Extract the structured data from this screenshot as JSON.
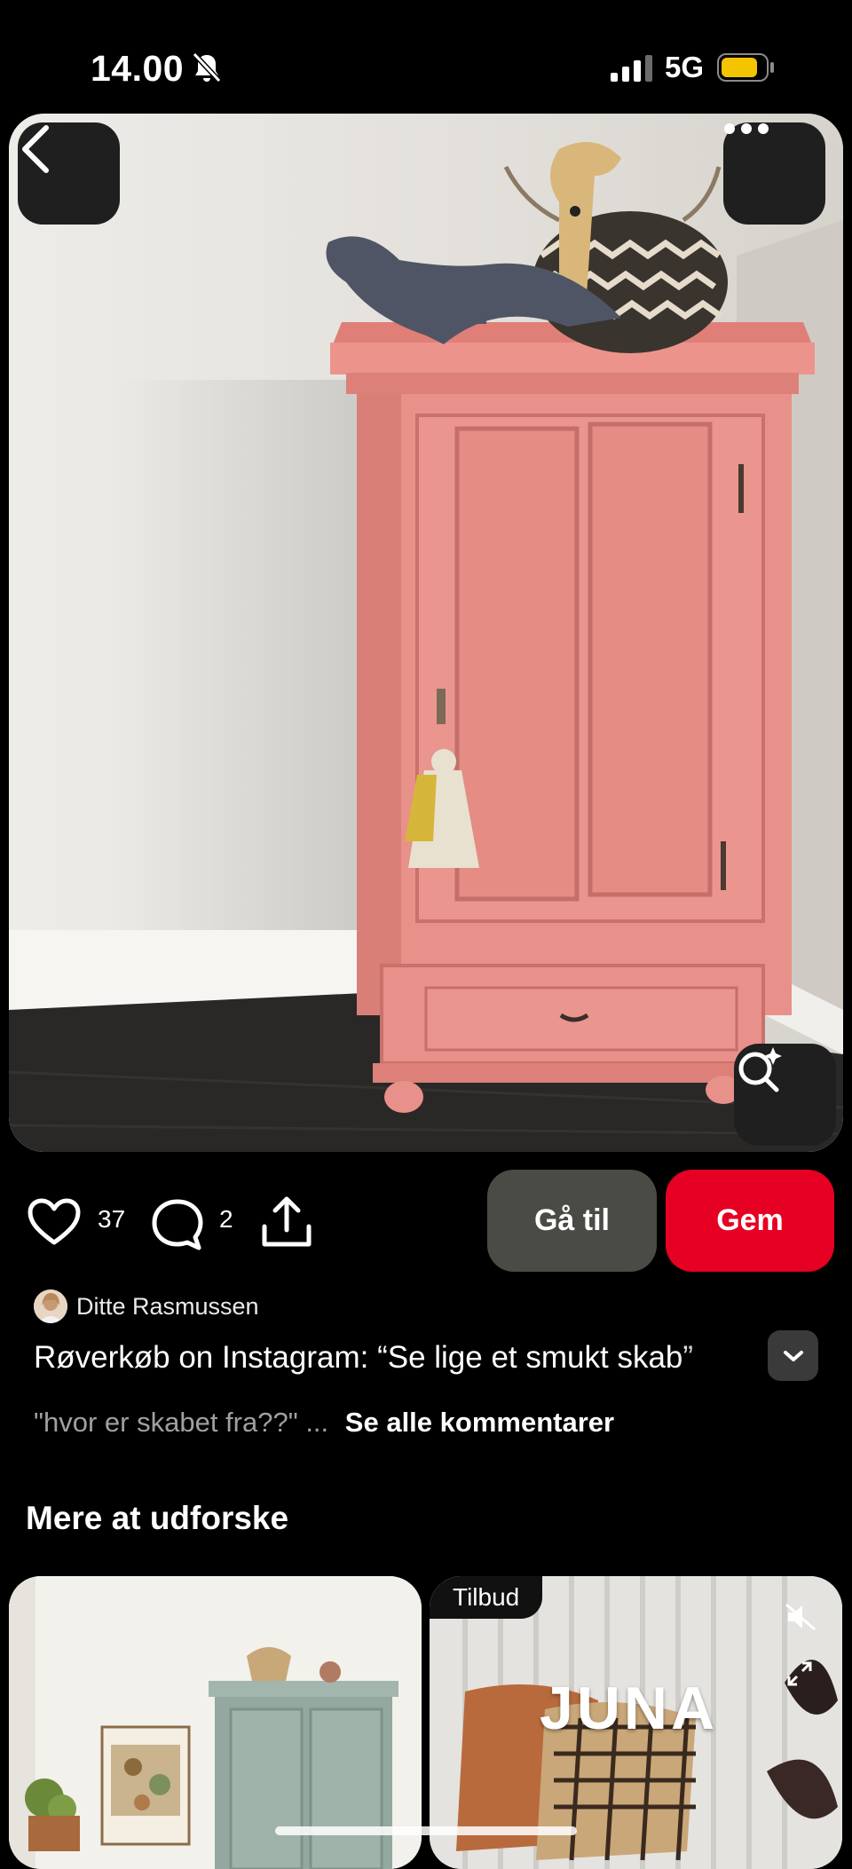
{
  "status_bar": {
    "time": "14.00",
    "network": "5G",
    "battery_color": "#f5c400"
  },
  "pin": {
    "likes": "37",
    "comments": "2",
    "goto_label": "Gå til",
    "save_label": "Gem",
    "author": "Ditte Rasmussen",
    "title": "Røverkøb on Instagram: “Se lige et smukt skab”",
    "comment_preview": "\"hvor er skabet fra??\" ...",
    "see_all_comments": "Se alle kommentarer"
  },
  "explore": {
    "heading": "Mere at udforske",
    "cards": [
      {
        "badge": "",
        "brand": ""
      },
      {
        "badge": "Tilbud",
        "brand": "JUNA"
      }
    ]
  },
  "colors": {
    "save": "#e60023",
    "goto": "#4b4b46",
    "cabinet": "#e8908a"
  }
}
